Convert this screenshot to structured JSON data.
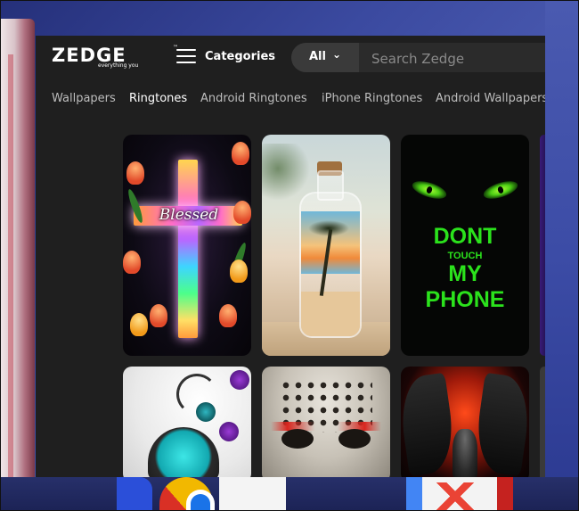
{
  "app": {
    "logo": "ZEDGE",
    "logo_tm": "™",
    "tagline": "everything you",
    "categories_label": "Categories"
  },
  "search": {
    "filter_label": "All",
    "placeholder": "Search Zedge"
  },
  "nav": {
    "items": [
      {
        "label": "Wallpapers",
        "active": false
      },
      {
        "label": "Ringtones",
        "active": true
      },
      {
        "label": "Android Ringtones",
        "active": false
      },
      {
        "label": "iPhone Ringtones",
        "active": false
      },
      {
        "label": "Android Wallpapers",
        "active": false
      }
    ]
  },
  "cards": [
    {
      "subject": "rainbow-cross-tulips",
      "text": "Blessed"
    },
    {
      "subject": "palm-tree-in-bottle-beach"
    },
    {
      "subject": "green-eyes-phone-warning",
      "lines": [
        "DONT",
        "TOUCH",
        "MY",
        "PHONE"
      ]
    },
    {
      "subject": "purple-edge-partial"
    },
    {
      "subject": "heart-roses-swirl"
    },
    {
      "subject": "hockey-mask"
    },
    {
      "subject": "dark-angel-fire"
    },
    {
      "subject": "partial-card"
    }
  ],
  "colors": {
    "app_bg": "#1f1f1f",
    "accent_green": "#2be21c",
    "nav_text": "#bdbdbd"
  }
}
